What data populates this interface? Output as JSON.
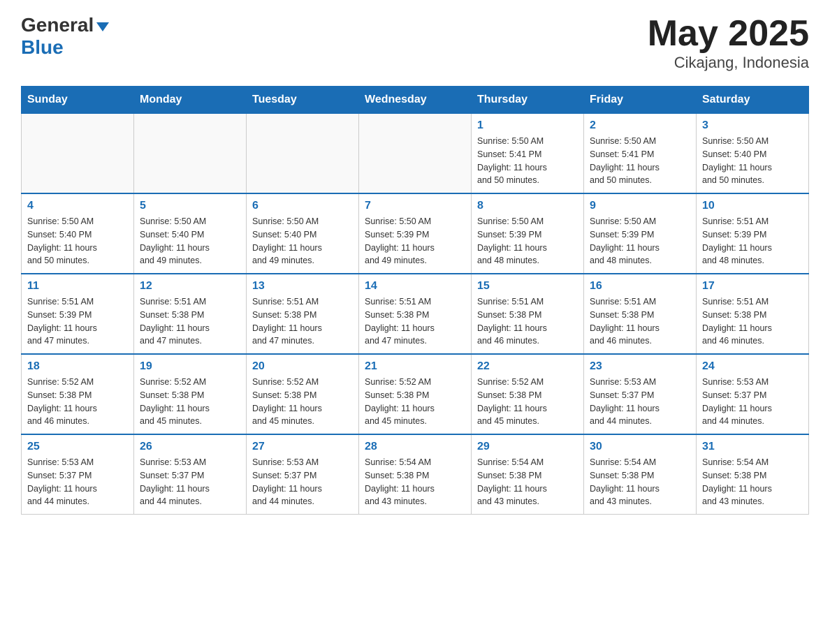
{
  "header": {
    "logo_general": "General",
    "logo_blue": "Blue",
    "title": "May 2025",
    "subtitle": "Cikajang, Indonesia"
  },
  "days_of_week": [
    "Sunday",
    "Monday",
    "Tuesday",
    "Wednesday",
    "Thursday",
    "Friday",
    "Saturday"
  ],
  "weeks": [
    {
      "days": [
        {
          "number": "",
          "info": ""
        },
        {
          "number": "",
          "info": ""
        },
        {
          "number": "",
          "info": ""
        },
        {
          "number": "",
          "info": ""
        },
        {
          "number": "1",
          "info": "Sunrise: 5:50 AM\nSunset: 5:41 PM\nDaylight: 11 hours\nand 50 minutes."
        },
        {
          "number": "2",
          "info": "Sunrise: 5:50 AM\nSunset: 5:41 PM\nDaylight: 11 hours\nand 50 minutes."
        },
        {
          "number": "3",
          "info": "Sunrise: 5:50 AM\nSunset: 5:40 PM\nDaylight: 11 hours\nand 50 minutes."
        }
      ]
    },
    {
      "days": [
        {
          "number": "4",
          "info": "Sunrise: 5:50 AM\nSunset: 5:40 PM\nDaylight: 11 hours\nand 50 minutes."
        },
        {
          "number": "5",
          "info": "Sunrise: 5:50 AM\nSunset: 5:40 PM\nDaylight: 11 hours\nand 49 minutes."
        },
        {
          "number": "6",
          "info": "Sunrise: 5:50 AM\nSunset: 5:40 PM\nDaylight: 11 hours\nand 49 minutes."
        },
        {
          "number": "7",
          "info": "Sunrise: 5:50 AM\nSunset: 5:39 PM\nDaylight: 11 hours\nand 49 minutes."
        },
        {
          "number": "8",
          "info": "Sunrise: 5:50 AM\nSunset: 5:39 PM\nDaylight: 11 hours\nand 48 minutes."
        },
        {
          "number": "9",
          "info": "Sunrise: 5:50 AM\nSunset: 5:39 PM\nDaylight: 11 hours\nand 48 minutes."
        },
        {
          "number": "10",
          "info": "Sunrise: 5:51 AM\nSunset: 5:39 PM\nDaylight: 11 hours\nand 48 minutes."
        }
      ]
    },
    {
      "days": [
        {
          "number": "11",
          "info": "Sunrise: 5:51 AM\nSunset: 5:39 PM\nDaylight: 11 hours\nand 47 minutes."
        },
        {
          "number": "12",
          "info": "Sunrise: 5:51 AM\nSunset: 5:38 PM\nDaylight: 11 hours\nand 47 minutes."
        },
        {
          "number": "13",
          "info": "Sunrise: 5:51 AM\nSunset: 5:38 PM\nDaylight: 11 hours\nand 47 minutes."
        },
        {
          "number": "14",
          "info": "Sunrise: 5:51 AM\nSunset: 5:38 PM\nDaylight: 11 hours\nand 47 minutes."
        },
        {
          "number": "15",
          "info": "Sunrise: 5:51 AM\nSunset: 5:38 PM\nDaylight: 11 hours\nand 46 minutes."
        },
        {
          "number": "16",
          "info": "Sunrise: 5:51 AM\nSunset: 5:38 PM\nDaylight: 11 hours\nand 46 minutes."
        },
        {
          "number": "17",
          "info": "Sunrise: 5:51 AM\nSunset: 5:38 PM\nDaylight: 11 hours\nand 46 minutes."
        }
      ]
    },
    {
      "days": [
        {
          "number": "18",
          "info": "Sunrise: 5:52 AM\nSunset: 5:38 PM\nDaylight: 11 hours\nand 46 minutes."
        },
        {
          "number": "19",
          "info": "Sunrise: 5:52 AM\nSunset: 5:38 PM\nDaylight: 11 hours\nand 45 minutes."
        },
        {
          "number": "20",
          "info": "Sunrise: 5:52 AM\nSunset: 5:38 PM\nDaylight: 11 hours\nand 45 minutes."
        },
        {
          "number": "21",
          "info": "Sunrise: 5:52 AM\nSunset: 5:38 PM\nDaylight: 11 hours\nand 45 minutes."
        },
        {
          "number": "22",
          "info": "Sunrise: 5:52 AM\nSunset: 5:38 PM\nDaylight: 11 hours\nand 45 minutes."
        },
        {
          "number": "23",
          "info": "Sunrise: 5:53 AM\nSunset: 5:37 PM\nDaylight: 11 hours\nand 44 minutes."
        },
        {
          "number": "24",
          "info": "Sunrise: 5:53 AM\nSunset: 5:37 PM\nDaylight: 11 hours\nand 44 minutes."
        }
      ]
    },
    {
      "days": [
        {
          "number": "25",
          "info": "Sunrise: 5:53 AM\nSunset: 5:37 PM\nDaylight: 11 hours\nand 44 minutes."
        },
        {
          "number": "26",
          "info": "Sunrise: 5:53 AM\nSunset: 5:37 PM\nDaylight: 11 hours\nand 44 minutes."
        },
        {
          "number": "27",
          "info": "Sunrise: 5:53 AM\nSunset: 5:37 PM\nDaylight: 11 hours\nand 44 minutes."
        },
        {
          "number": "28",
          "info": "Sunrise: 5:54 AM\nSunset: 5:38 PM\nDaylight: 11 hours\nand 43 minutes."
        },
        {
          "number": "29",
          "info": "Sunrise: 5:54 AM\nSunset: 5:38 PM\nDaylight: 11 hours\nand 43 minutes."
        },
        {
          "number": "30",
          "info": "Sunrise: 5:54 AM\nSunset: 5:38 PM\nDaylight: 11 hours\nand 43 minutes."
        },
        {
          "number": "31",
          "info": "Sunrise: 5:54 AM\nSunset: 5:38 PM\nDaylight: 11 hours\nand 43 minutes."
        }
      ]
    }
  ]
}
